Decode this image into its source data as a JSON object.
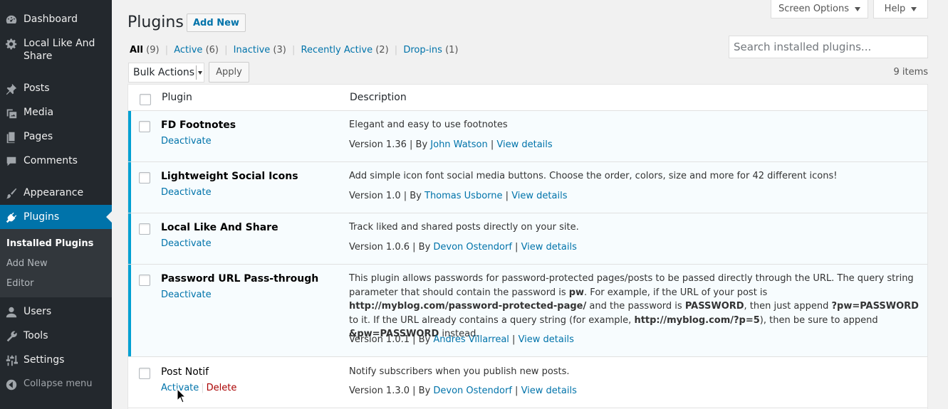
{
  "sidebar": {
    "items": [
      {
        "label": "Dashboard",
        "icon": "dashboard-icon"
      },
      {
        "label": "Local Like And Share",
        "icon": "gear-icon"
      },
      {
        "label": "Posts",
        "icon": "pushpin-icon"
      },
      {
        "label": "Media",
        "icon": "media-icon"
      },
      {
        "label": "Pages",
        "icon": "pages-icon"
      },
      {
        "label": "Comments",
        "icon": "comment-icon"
      },
      {
        "label": "Appearance",
        "icon": "brush-icon"
      },
      {
        "label": "Plugins",
        "icon": "plug-icon"
      },
      {
        "label": "Users",
        "icon": "user-icon"
      },
      {
        "label": "Tools",
        "icon": "wrench-icon"
      },
      {
        "label": "Settings",
        "icon": "settings-icon"
      }
    ],
    "submenu": [
      "Installed Plugins",
      "Add New",
      "Editor"
    ],
    "collapse_label": "Collapse menu"
  },
  "header": {
    "screen_options": "Screen Options",
    "help": "Help",
    "title": "Plugins",
    "add_new": "Add New"
  },
  "filters": {
    "all": "All",
    "all_count": "(9)",
    "active": "Active",
    "active_count": "(6)",
    "inactive": "Inactive",
    "inactive_count": "(3)",
    "recent": "Recently Active",
    "recent_count": "(2)",
    "dropins": "Drop-ins",
    "dropins_count": "(1)",
    "sep": "|"
  },
  "search": {
    "placeholder": "Search installed plugins..."
  },
  "bulk": {
    "selected": "Bulk Actions",
    "apply": "Apply",
    "items_count": "9 items"
  },
  "table": {
    "col_plugin": "Plugin",
    "col_description": "Description",
    "rows": [
      {
        "name": "FD Footnotes",
        "action": "Deactivate",
        "desc": "Elegant and easy to use footnotes",
        "version": "Version 1.36 | By ",
        "author": "John Watson",
        "sep": " | ",
        "details": "View details"
      },
      {
        "name": "Lightweight Social Icons",
        "action": "Deactivate",
        "desc": "Add simple icon font social media buttons. Choose the order, colors, size and more for 42 different icons!",
        "version": "Version 1.0 | By ",
        "author": "Thomas Usborne",
        "sep": " | ",
        "details": "View details"
      },
      {
        "name": "Local Like And Share",
        "action": "Deactivate",
        "desc": "Track liked and shared posts directly on your site.",
        "version": "Version 1.0.6 | By ",
        "author": "Devon Ostendorf",
        "sep": " | ",
        "details": "View details"
      },
      {
        "name": "Password URL Pass-through",
        "action": "Deactivate",
        "desc_parts": [
          "This plugin allows passwords for password-protected pages/posts to be passed directly through the URL. The query string parameter that should contain the password is ",
          "pw",
          ". For example, if the URL of your post is ",
          "http://myblog.com/password-protected-page/",
          " and the password is ",
          "PASSWORD",
          ", then just append ",
          "?pw=PASSWORD",
          " to it. If the URL already contains a query string (for example, ",
          "http://myblog.com/?p=5",
          "), then be sure to append ",
          "&pw=PASSWORD",
          " instead."
        ],
        "version": "Version 1.0.1 | By ",
        "author": "Andres Villarreal",
        "sep": " | ",
        "details": "View details"
      },
      {
        "name": "Post Notif",
        "action": "Activate",
        "action2": "Delete",
        "desc": "Notify subscribers when you publish new posts.",
        "version": "Version 1.3.0 | By ",
        "author": "Devon Ostendorf",
        "sep": " | ",
        "details": "View details"
      }
    ]
  },
  "colors": {
    "accent": "#0073aa",
    "sidebar": "#23282d",
    "active_border": "#00a0d2",
    "delete": "#aa0000"
  }
}
